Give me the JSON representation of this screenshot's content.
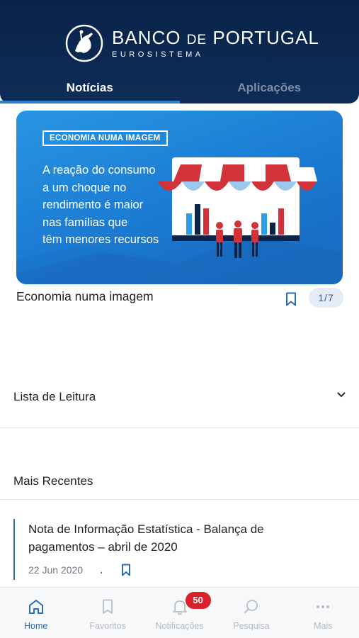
{
  "header": {
    "brand_line1_main": "BANCO ",
    "brand_line1_small": "DE",
    "brand_line1_end": " PORTUGAL",
    "brand_line2": "EUROSISTEMA",
    "tabs": [
      {
        "label": "Notícias",
        "active": true
      },
      {
        "label": "Aplicações",
        "active": false
      }
    ]
  },
  "banner": {
    "tag": "ECONOMIA NUMA IMAGEM",
    "lines": [
      "A reação do consumo",
      "a um choque no",
      "rendimento é maior",
      "nas famílias que",
      "têm menores recursos"
    ],
    "caption": "Economia numa imagem",
    "pager": "1/7"
  },
  "reading_list": {
    "title": "Lista de Leitura"
  },
  "recent": {
    "title": "Mais Recentes",
    "articles": [
      {
        "title": "Nota de Informação Estatística - Balança de pagamentos – abril de 2020",
        "date": "22 Jun 2020",
        "separator": "."
      }
    ]
  },
  "bottom_nav": {
    "items": [
      {
        "label": "Home",
        "icon": "home-icon",
        "active": true
      },
      {
        "label": "Favoritos",
        "icon": "bookmark-icon",
        "active": false
      },
      {
        "label": "Notificações",
        "icon": "bell-icon",
        "active": false,
        "badge": "50"
      },
      {
        "label": "Pesquisa",
        "icon": "search-icon",
        "active": false
      },
      {
        "label": "Mais",
        "icon": "more-icon",
        "active": false
      }
    ]
  },
  "colors": {
    "header_bg": "#0b2550",
    "accent": "#2a6eb8",
    "banner_bg": "#1b7cd3",
    "badge": "#d8212a",
    "awning_red": "#d2323a"
  }
}
